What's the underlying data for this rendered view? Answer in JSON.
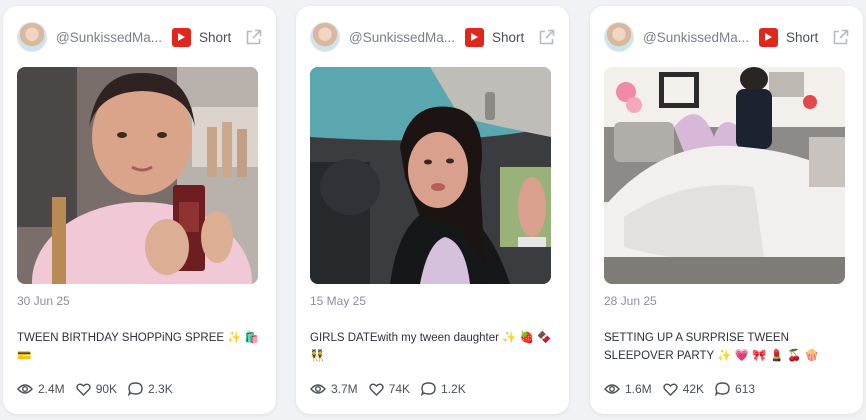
{
  "cards": [
    {
      "handle": "@SunkissedMa...",
      "platform_label": "Short",
      "date": "30 Jun 25",
      "caption": "TWEEN BIRTHDAY SHOPPiNG SPREE ✨ 🛍️ 💳",
      "views": "2.4M",
      "likes": "90K",
      "comments": "2.3K"
    },
    {
      "handle": "@SunkissedMa...",
      "platform_label": "Short",
      "date": "15 May 25",
      "caption": "GIRLS DATEwith my tween daughter ✨ 🍓 🍫 👯",
      "views": "3.7M",
      "likes": "74K",
      "comments": "1.2K"
    },
    {
      "handle": "@SunkissedMa...",
      "platform_label": "Short",
      "date": "28 Jun 25",
      "caption": "SETTING UP A SURPRISE TWEEN SLEEPOVER PARTY ✨ 💗 🎀 💄 🍒 🍿",
      "views": "1.6M",
      "likes": "42K",
      "comments": "613"
    }
  ],
  "icons": {
    "platform": "youtube-icon",
    "external": "external-link-icon",
    "views": "eye-icon",
    "likes": "heart-icon",
    "comments": "comment-icon"
  },
  "colors": {
    "youtube_red": "#e1261c",
    "card_bg": "#ffffff",
    "page_bg": "#f1f2f5"
  }
}
